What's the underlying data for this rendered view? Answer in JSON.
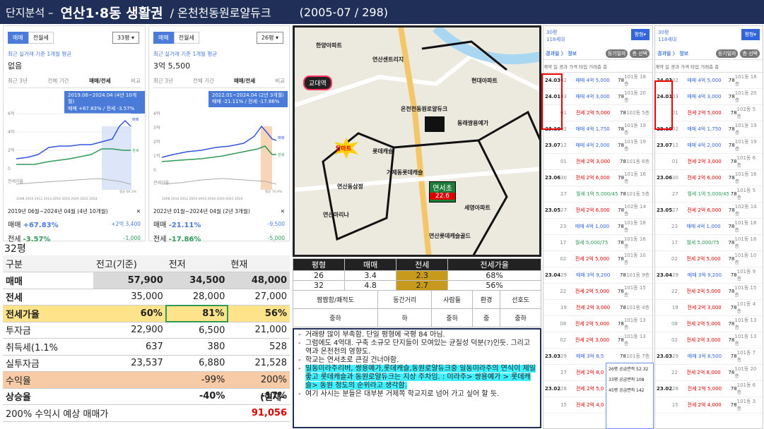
{
  "header": {
    "prefix": "단지분석 –",
    "title": "연산1·8동 생활권",
    "subtitle": "/ 온천천동원로얄듀크",
    "info": "(2005-07 / 298)"
  },
  "left_chart": {
    "sale_tab": "매매",
    "rent_tab": "전월세",
    "pyeong": "33평 ▾",
    "subtitle": "최근 실거래 기준 1개월 평균",
    "price": "없음",
    "tabs": [
      "최근 3년",
      "전체 기간",
      "매매/전세",
      "비교"
    ],
    "tip_line1": "2019.06~2024.04 (4년 10개월)",
    "tip_line2": "매매 +67.83% / 전세 -3.57%",
    "y_ticks": [
      "6억",
      "4억",
      "2억",
      "0",
      "전세가율"
    ],
    "x_labels": "2008 2010 2012 2014 2016 2018 2020 2022 2024",
    "right_labels": [
      "매매",
      "전세",
      "평균 66.3%"
    ],
    "period": "2019년 06월~2024년 04월 (4년 10개월)",
    "close": "✕",
    "sale_label": "매매",
    "sale_pct": "+67.83%",
    "sale_amt": "+2억 3,400",
    "rent_label": "전세",
    "rent_pct": "-3.57%",
    "rent_amt": "-1,000"
  },
  "right_chart": {
    "sale_tab": "매매",
    "rent_tab": "전월세",
    "pyeong": "26평 ▾",
    "subtitle": "최근 실거래 기준 1개월 평균",
    "price": "3억 5,500",
    "tabs": [
      "최근 3년",
      "전체 기간",
      "매매/전세",
      "비교"
    ],
    "tip_line1": "2022.01~2024.04 (2년 3개월)",
    "tip_line2": "매매 -21.11% / 전세 -17.86%",
    "y_ticks": [
      "4억",
      "3억",
      "2억",
      "1억",
      "0",
      "전세가율"
    ],
    "x_labels": "2008 2010 2012 2014 2016 2018 2020 2022 2024",
    "right_labels": [
      "매매",
      "전세",
      "평균 70.9%"
    ],
    "period": "2022년 01월~2024년 04월 (2년 3개월)",
    "close": "✕",
    "sale_label": "매매",
    "sale_pct": "-21.11%",
    "sale_amt": "-9,500",
    "rent_label": "전세",
    "rent_pct": "-17.86%",
    "rent_amt": "-5,000"
  },
  "map": {
    "daemot": "교대역",
    "homeplus": "탑마트",
    "yeonseo": "연서초",
    "yeonseo_no": "22.6",
    "labels": [
      "한양아파트",
      "연산센트리지",
      "현대아파트",
      "온천천동원로얄듀크",
      "동래쌍용예가",
      "롯데캐슬",
      "연산동삼정",
      "거제동롯데캐슬",
      "연산마리나",
      "세영아파트",
      "연산롯데캐슬골드"
    ]
  },
  "table": {
    "pyeong": "32평",
    "headers": [
      "구분",
      "전고(기준)",
      "전저",
      "현재"
    ],
    "rows": [
      [
        "매매",
        "57,900",
        "34,500",
        "48,000"
      ],
      [
        "전세",
        "35,000",
        "28,000",
        "27,000"
      ],
      [
        "전세가율",
        "60%",
        "81%",
        "56%"
      ],
      [
        "투자금",
        "22,900",
        "6,500",
        "21,000"
      ],
      [
        "취득세(1.1%",
        "637",
        "380",
        "528"
      ],
      [
        "실투자금",
        "23,537",
        "6,880",
        "21,528"
      ],
      [
        "수익율",
        "",
        "-99%",
        "200%"
      ],
      [
        "상승율",
        "",
        "-40%",
        "-17%"
      ]
    ],
    "tail": "(현재-",
    "footer_label": "200% 수익시 예상 매매가",
    "footer_value": "91,056"
  },
  "ratio": {
    "headers": [
      "평형",
      "매매",
      "전세",
      "전세가율"
    ],
    "rows": [
      [
        "26",
        "3.4",
        "2.3",
        "68%"
      ],
      [
        "32",
        "4.8",
        "2.7",
        "56%"
      ]
    ]
  },
  "eval": {
    "headers": [
      "짬짬함/쾌적도",
      "동간거리",
      "사람들",
      "환경",
      "선호도"
    ],
    "values": [
      "중하",
      "하",
      "중하",
      "중",
      "중하"
    ]
  },
  "notes": [
    "거래량 많이 부족함. 단일 평형에 국평 84 아님.",
    "그럼에도 4억대. 구축 소규모 단지들이 모여있는 균질성 덕분(?)인듯. 그리고 역과 온천천의 영향도.",
    "학교는 연서초로 큰길 건너야함.",
    "일동미라주리버, 쌍용예가,롯데캐슬,동원로얄듀크중 일동미라주의 연식이 제일 좋고 롯데캐슬과 동원로얄듀크는 지상 주차임. : 미라주> 쌍용예가 > 롯데캐슬> 동원 정도의 순위라고 생각함.",
    "여기 사시는 분들은 대부분 거제쪽 학교지로 넘어 가고 싶어 할 듯."
  ],
  "list1": {
    "py": "30평",
    "units": "118세대",
    "btn": "평형▾",
    "crumb": "경과일 〉 정보",
    "pills": [
      "등기일자",
      "층 선택"
    ],
    "cols": "계약 일 경과 가격 타입 거래층 층",
    "entries": [
      [
        "24.03",
        "02",
        "매매 4억 5,000",
        "78",
        "101동 18층"
      ],
      [
        "24.01",
        "03",
        "매매 4억 3,000",
        "78",
        "101동 20층"
      ],
      [
        "",
        "01",
        "전세 2억 5,000",
        "78",
        "102동 5층"
      ],
      [
        "23.10",
        "02",
        "매매 4억 1,750",
        "78",
        "101동 19층"
      ],
      [
        "23.07",
        "12",
        "매매 4억 2,000",
        "78",
        "101동 19층"
      ],
      [
        "",
        "01",
        "전세 2억 3,000",
        "78",
        "101동 6층"
      ],
      [
        "23.06",
        "30",
        "전세 2억 6,000",
        "78",
        "101동 16층"
      ],
      [
        "",
        "27",
        "월세 1억 5,000/45",
        "78",
        "101동 5층"
      ],
      [
        "23.05",
        "27",
        "전세 2억 6,000",
        "78",
        "102동 14층"
      ],
      [
        "",
        "23",
        "매매 4억 1,000",
        "78",
        "101동 18층"
      ],
      [
        "",
        "17",
        "월세 5,000/75",
        "78",
        "101동 16층"
      ],
      [
        "",
        "02",
        "전세 2억 5,000",
        "78",
        "101동 10층"
      ],
      [
        "23.04",
        "29",
        "매매 3억 9,200",
        "78",
        "101동 9층"
      ],
      [
        "",
        "22",
        "전세 2억 5,000",
        "78",
        "101동 15층"
      ],
      [
        "",
        "19",
        "전세 2억 3,000",
        "78",
        "101동 4층"
      ],
      [
        "",
        "08",
        "전세 2억 5,000",
        "78",
        "101동 13층"
      ],
      [
        "",
        "02",
        "전세 2억 3,000",
        "78",
        "101동 13층"
      ],
      [
        "23.03",
        "29",
        "매매 3억 8,5",
        "78",
        "101동 7층"
      ],
      [
        "",
        "27",
        "전세 2억 8,0",
        "78",
        "101동 2층"
      ],
      [
        "23.02",
        "28",
        "전세 2억 5,0",
        "78",
        "101동 6층"
      ],
      [
        "",
        "15",
        "전세 2억 4,0",
        "78",
        "101동 3층"
      ]
    ]
  },
  "list2": {
    "py": "30평",
    "units": "118세대",
    "btn": "평형▾",
    "crumb": "경과일 〉 정보",
    "pills": [
      "등기일자",
      "층 선택"
    ],
    "cols": "계약 일 경과 가격 타입 거래층 층",
    "entries": [
      [
        "24.03",
        "02",
        "매매 4억 5,000",
        "78",
        "101동 18층"
      ],
      [
        "24.01",
        "03",
        "매매 4억 3,000",
        "78",
        "101동 20층"
      ],
      [
        "",
        "01",
        "전세 2억 5,000",
        "78",
        "102동 5층"
      ],
      [
        "23.10",
        "02",
        "매매 4억 1,750",
        "78",
        "101동 19층"
      ],
      [
        "23.07",
        "12",
        "매매 4억 2,000",
        "78",
        "101동 19층"
      ],
      [
        "",
        "01",
        "전세 2억 3,000",
        "78",
        "101동 6층"
      ],
      [
        "23.06",
        "30",
        "전세 2억 6,000",
        "78",
        "101동 16층"
      ],
      [
        "",
        "27",
        "월세 1억 5,000/45",
        "78",
        "101동 5층"
      ],
      [
        "23.05",
        "27",
        "전세 2억 6,000",
        "78",
        "102동 14층"
      ],
      [
        "",
        "23",
        "매매 4억 1,000",
        "78",
        "101동 18층"
      ],
      [
        "",
        "17",
        "월세 5,000/75",
        "78",
        "101동 16층"
      ],
      [
        "",
        "02",
        "전세 2억 5,000",
        "78",
        "101동 10층"
      ],
      [
        "23.04",
        "29",
        "매매 3억 9,200",
        "78",
        "101동 9층"
      ],
      [
        "",
        "22",
        "전세 2억 5,000",
        "78",
        "101동 15층"
      ],
      [
        "",
        "19",
        "전세 2억 3,000",
        "78",
        "101동 4층"
      ],
      [
        "",
        "08",
        "전세 2억 5,000",
        "78",
        "101동 13층"
      ],
      [
        "",
        "02",
        "전세 2억 3,000",
        "78",
        "101동 13층"
      ],
      [
        "23.03",
        "29",
        "매매 3억 8,500",
        "78",
        "101동 7층"
      ],
      [
        "",
        "22",
        "전세 2억 8,000",
        "78",
        "101동 20층"
      ],
      [
        "23.02",
        "28",
        "전세 2억 5,000",
        "78",
        "101동 6층"
      ],
      [
        "",
        "15",
        "전세 2억 4,000",
        "78",
        "101동 3층"
      ]
    ]
  },
  "popup": {
    "a": "26평 공급면적 52.32",
    "b": "33평 공급면적 108",
    "c": "45평 공급면적 142"
  }
}
